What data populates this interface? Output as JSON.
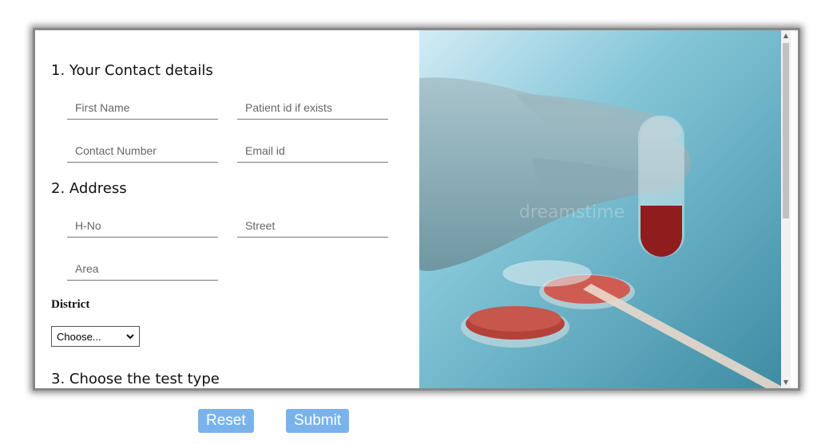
{
  "form": {
    "section1_title": "1. Your Contact details",
    "section2_title": "2. Address",
    "section3_title": "3. Choose the test type",
    "first_name_placeholder": "First Name",
    "patient_id_placeholder": "Patient id if exists",
    "contact_number_placeholder": "Contact Number",
    "email_placeholder": "Email id",
    "hno_placeholder": "H-No",
    "street_placeholder": "Street",
    "area_placeholder": "Area",
    "district_label": "District",
    "district_selected": "Choose...",
    "reset_label": "Reset",
    "submit_label": "Submit"
  },
  "image": {
    "watermark": "dreamstime"
  },
  "colors": {
    "button": "#7ab3ec",
    "frame_border": "#888888"
  }
}
